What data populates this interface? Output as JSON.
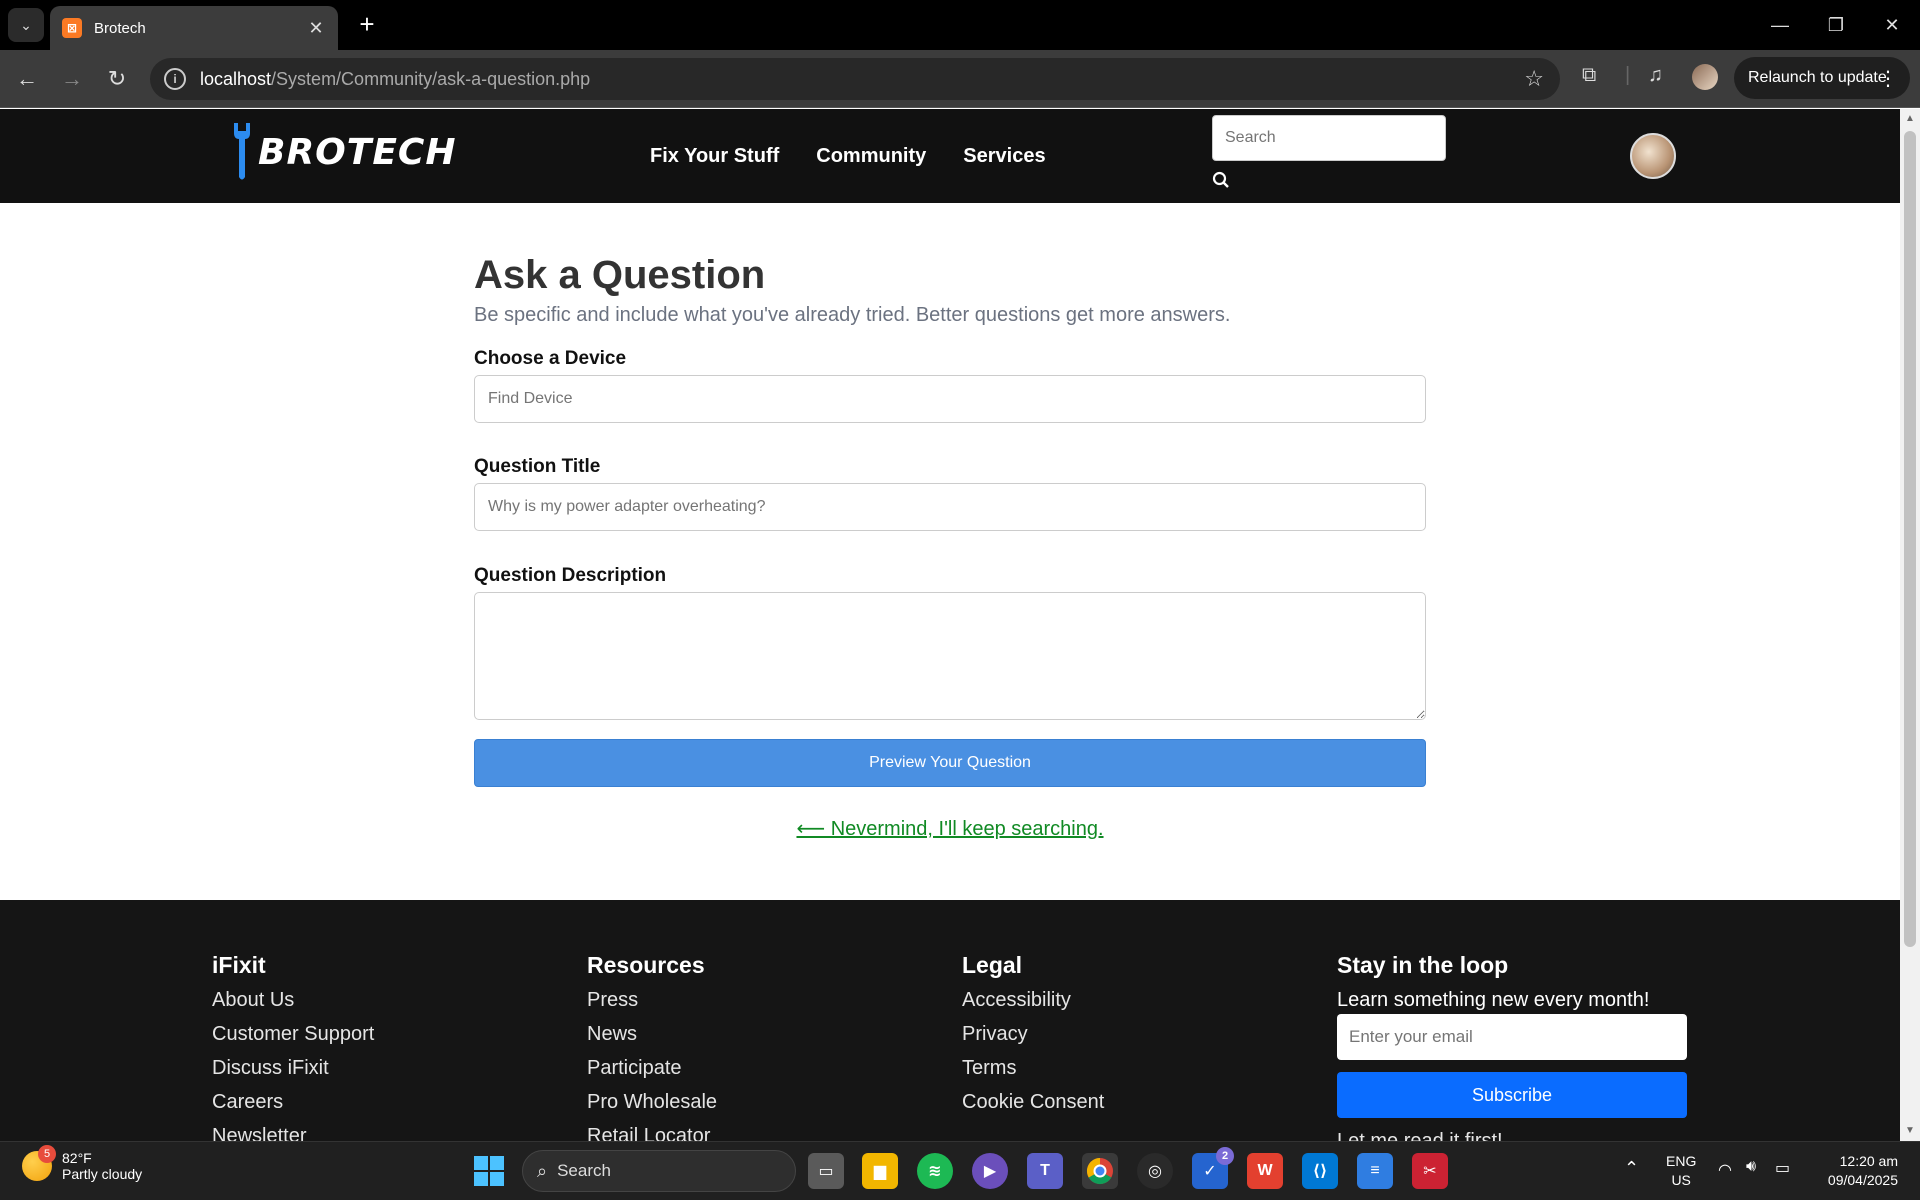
{
  "browser": {
    "tab_title": "Brotech",
    "url_host": "localhost",
    "url_path": "/System/Community/ask-a-question.php",
    "relaunch_label": "Relaunch to update"
  },
  "site": {
    "nav": [
      "Fix Your Stuff",
      "Community",
      "Services"
    ],
    "search_placeholder": "Search",
    "logo_text": "BROTECH"
  },
  "form": {
    "title": "Ask a Question",
    "subtitle": "Be specific and include what you've already tried. Better questions get more answers.",
    "device_label": "Choose a Device",
    "device_placeholder": "Find Device",
    "question_title_label": "Question Title",
    "question_title_placeholder": "Why is my power adapter overheating?",
    "description_label": "Question Description",
    "preview_button": "Preview Your Question",
    "nevermind_link": "⟵ Nevermind, I'll keep searching."
  },
  "footer": {
    "col1": {
      "heading": "iFixit",
      "links": [
        "About Us",
        "Customer Support",
        "Discuss iFixit",
        "Careers",
        "Newsletter"
      ]
    },
    "col2": {
      "heading": "Resources",
      "links": [
        "Press",
        "News",
        "Participate",
        "Pro Wholesale",
        "Retail Locator"
      ]
    },
    "col3": {
      "heading": "Legal",
      "links": [
        "Accessibility",
        "Privacy",
        "Terms",
        "Cookie Consent"
      ]
    },
    "col4": {
      "heading": "Stay in the loop",
      "subheading": "Learn something new every month!",
      "email_placeholder": "Enter your email",
      "subscribe_button": "Subscribe",
      "read_first": "Let me read it first!"
    }
  },
  "taskbar": {
    "weather_temp": "82°F",
    "weather_desc": "Partly cloudy",
    "weather_badge": "5",
    "search_label": "Search",
    "todo_badge": "2",
    "lang_top": "ENG",
    "lang_bottom": "US",
    "time": "12:20 am",
    "date": "09/04/2025"
  },
  "colors": {
    "accent_blue": "#4a90e2",
    "nevermind_green": "#118a24",
    "subscribe_blue": "#0a6cff",
    "header_bg": "#111111"
  }
}
